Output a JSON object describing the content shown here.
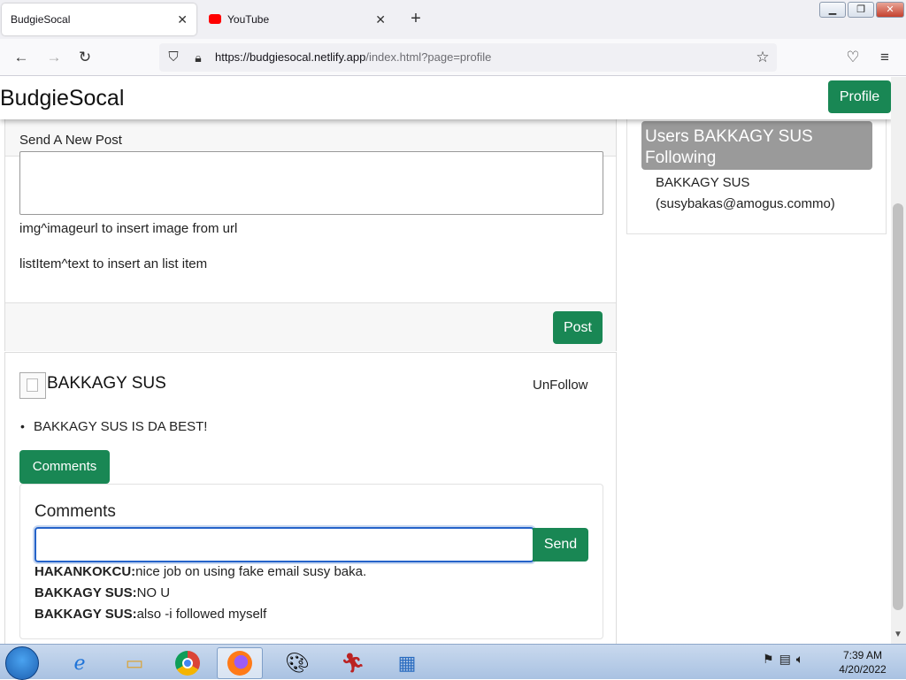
{
  "browser": {
    "tabs": [
      {
        "title": "BudgieSocal",
        "active": true
      },
      {
        "title": "YouTube",
        "active": false
      }
    ],
    "url_host": "https://budgiesocal.netlify.app",
    "url_path": "/index.html?page=profile"
  },
  "site": {
    "brand": "BudgieSocal",
    "profile_button": "Profile",
    "accent_color": "#198754"
  },
  "composer": {
    "title": "Send A New Post",
    "textarea_value": "",
    "hint_image": "img^imageurl to insert image from url",
    "hint_list": "listItem^text to insert an list item",
    "post_button": "Post"
  },
  "post": {
    "author": "BAKKAGY SUS",
    "unfollow_label": "UnFollow",
    "list_item": "BAKKAGY SUS IS DA BEST!",
    "comments_button": "Comments",
    "comments_title": "Comments",
    "comment_input_value": "",
    "send_button": "Send",
    "comments": [
      {
        "user": "HAKANKOKCU:",
        "text": "nice job on using fake email susy baka."
      },
      {
        "user": "BAKKAGY SUS:",
        "text": "NO U"
      },
      {
        "user": "BAKKAGY SUS:",
        "text": "also -i followed myself"
      }
    ]
  },
  "following": {
    "title": "Users BAKKAGY SUS Following",
    "user_name": "BAKKAGY SUS",
    "user_email": "(susybakas@amogus.commo)"
  },
  "taskbar": {
    "time": "7:39 AM",
    "date": "4/20/2022"
  }
}
